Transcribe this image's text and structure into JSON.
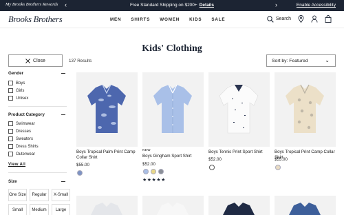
{
  "promo": {
    "rewards_label": "My Brooks Brothers Rewards",
    "message": "Free Standard Shipping on $200+",
    "details_link": "Details",
    "accessibility_link": "Enable Accessibility",
    "prev_arrow": "‹",
    "next_arrow": "›"
  },
  "header": {
    "logo": "Brooks Brothers",
    "nav": [
      "MEN",
      "SHIRTS",
      "WOMEN",
      "KIDS",
      "SALE"
    ],
    "search_label": "Search"
  },
  "page": {
    "title": "Kids' Clothing",
    "close_label": "Close",
    "results": "137 Results",
    "sort_label": "Sort by: Featured"
  },
  "filters": {
    "gender": {
      "title": "Gender",
      "options": [
        "Boys",
        "Girls",
        "Unisex"
      ]
    },
    "category": {
      "title": "Product Category",
      "options": [
        "Swimwear",
        "Dresses",
        "Sweaters",
        "Dress Shirts",
        "Outerwear"
      ]
    },
    "view_all": "View All",
    "size": {
      "title": "Size",
      "options": [
        "One Size",
        "Regular",
        "X-Small",
        "Small",
        "Medium",
        "Large"
      ]
    }
  },
  "products": [
    {
      "name": "Boys Tropical Palm Print Camp Collar Shirt",
      "price": "$55.00",
      "badge": "",
      "swatch_colors": [
        "#7d93c4"
      ],
      "shirt_color": "#4d67ae",
      "shirt_pattern": "#c5d3ee"
    },
    {
      "name": "Boys Gingham Sport Shirt",
      "price": "$52.00",
      "badge": "NEW",
      "swatch_colors": [
        "#a9bfe6",
        "#e8d88a",
        "#8a8f98"
      ],
      "shirt_color": "#a9c0e8",
      "shirt_pattern": "#ffffff",
      "rating": "★★★★★"
    },
    {
      "name": "Boys Tennis Print Sport Shirt",
      "price": "$52.00",
      "badge": "",
      "swatch_colors": [
        "#ffffff"
      ],
      "shirt_color": "#fbfbfb",
      "shirt_pattern": "#2b3550"
    },
    {
      "name": "Boys Tropical Print Camp Collar Shirt",
      "price": "$55.00",
      "badge": "",
      "swatch_colors": [
        "#e9dcc4"
      ],
      "shirt_color": "#ece0c8",
      "shirt_pattern": "#b8b1a2"
    }
  ],
  "colors": {
    "navy": "#1c2433",
    "accent_bar": "#1c2433"
  }
}
